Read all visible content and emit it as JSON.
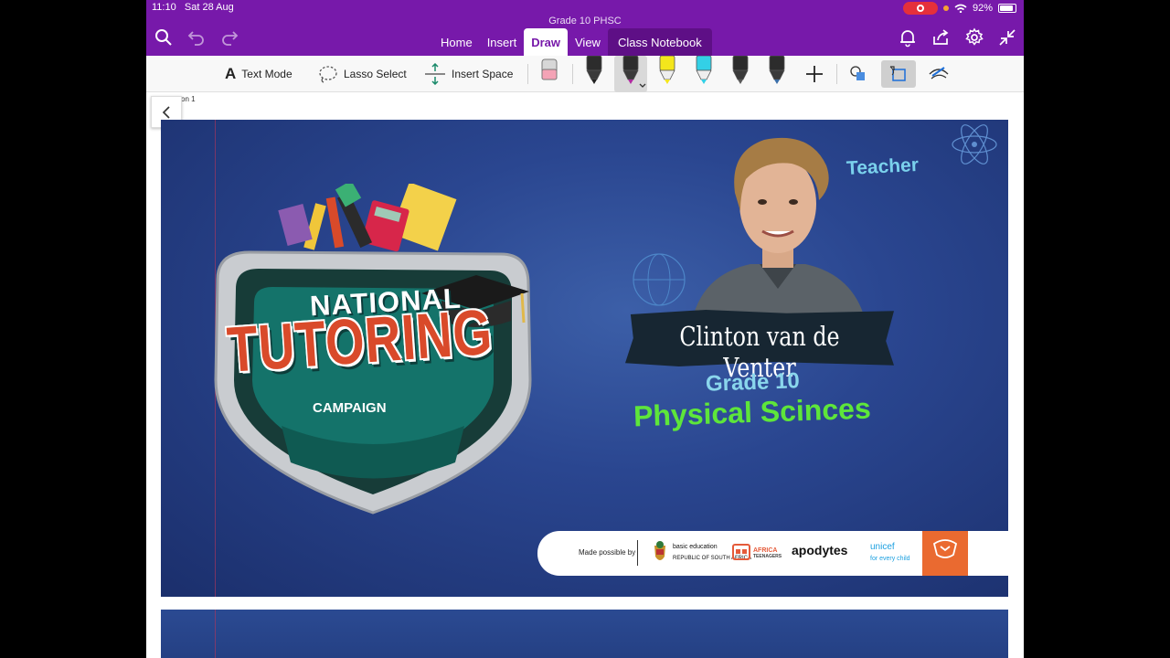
{
  "status_bar": {
    "time": "11:10",
    "date": "Sat 28 Aug",
    "battery": "92%"
  },
  "document": {
    "title": "Grade 10 PHSC"
  },
  "ribbon": {
    "tabs": [
      {
        "label": "Home"
      },
      {
        "label": "Insert"
      },
      {
        "label": "Draw"
      },
      {
        "label": "View"
      },
      {
        "label": "Class Notebook"
      }
    ],
    "active_tab": "Draw",
    "left_icons": [
      "search-icon",
      "undo-icon",
      "redo-icon"
    ],
    "right_icons": [
      "bell-icon",
      "share-icon",
      "gear-icon",
      "collapse-icon"
    ]
  },
  "toolbar": {
    "text_mode": "Text Mode",
    "lasso_select": "Lasso Select",
    "insert_space": "Insert Space",
    "pens": [
      {
        "color": "#222222"
      },
      {
        "color": "#b02aa0"
      },
      {
        "color": "#f4e61c"
      },
      {
        "color": "#33d0e6"
      },
      {
        "color": "#5a5a5a"
      },
      {
        "color": "#3a6ea8"
      }
    ],
    "selected_pen": 1
  },
  "page": {
    "tab_label": "on 1"
  },
  "slide": {
    "logo": {
      "line1": "NATIONAL",
      "line2": "TUTORING",
      "line3": "CAMPAIGN"
    },
    "teacher_label": "Teacher",
    "teacher_name": "Clinton van de Venter",
    "grade": "Grade 10",
    "subject": "Physical Scinces",
    "sponsors": {
      "made_possible_by": "Made possible by",
      "basic_education_line1": "basic education",
      "basic_education_line2": "REPUBLIC OF SOUTH AFRICA",
      "africa_teenagers_line1": "AFRICA",
      "africa_teenagers_line2": "TEENAGERS",
      "apodytes": "apodytes",
      "unicef": "unicef",
      "unicef_tagline": "for every child"
    }
  },
  "colors": {
    "onenote_purple": "#7719aa",
    "slide_blue": "#2a4690",
    "tutoring_red": "#d94a2a",
    "subject_green": "#5ee63a",
    "shield_teal": "#14736a"
  }
}
